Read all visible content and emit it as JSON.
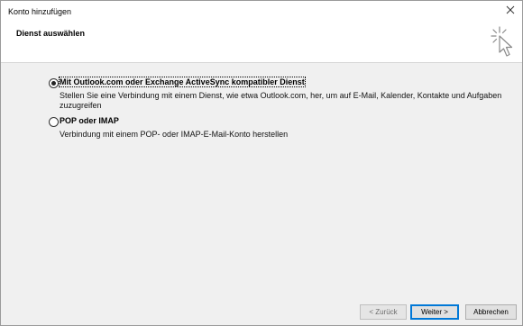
{
  "window": {
    "title": "Konto hinzufügen"
  },
  "header": {
    "title": "Dienst auswählen"
  },
  "options": [
    {
      "label": "Mit Outlook.com oder Exchange ActiveSync kompatibler Dienst",
      "selected": true,
      "description_lines": [
        "Stellen Sie eine Verbindung mit einem Dienst, wie etwa Outlook.com, her, um auf E-Mail, Kalender, Kontakte und Aufgaben",
        "zuzugreifen"
      ]
    },
    {
      "label": "POP oder IMAP",
      "selected": false,
      "description_lines": [
        "Verbindung mit einem POP- oder IMAP-E-Mail-Konto herstellen"
      ]
    }
  ],
  "buttons": {
    "back": "< Zurück",
    "next": "Weiter >",
    "cancel": "Abbrechen"
  }
}
